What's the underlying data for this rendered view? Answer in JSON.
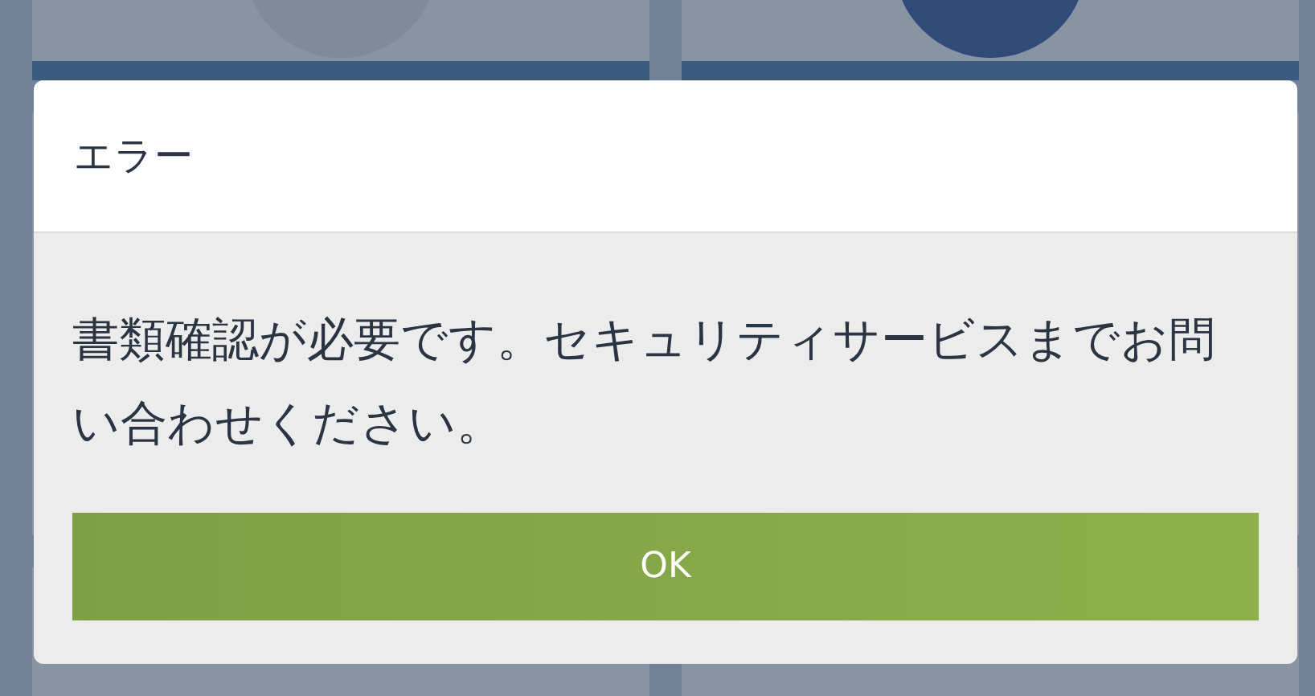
{
  "dialog": {
    "title": "エラー",
    "message": "書類確認が必要です。セキュリティサービスまでお問い合わせください。",
    "buttons": [
      "OK"
    ]
  }
}
